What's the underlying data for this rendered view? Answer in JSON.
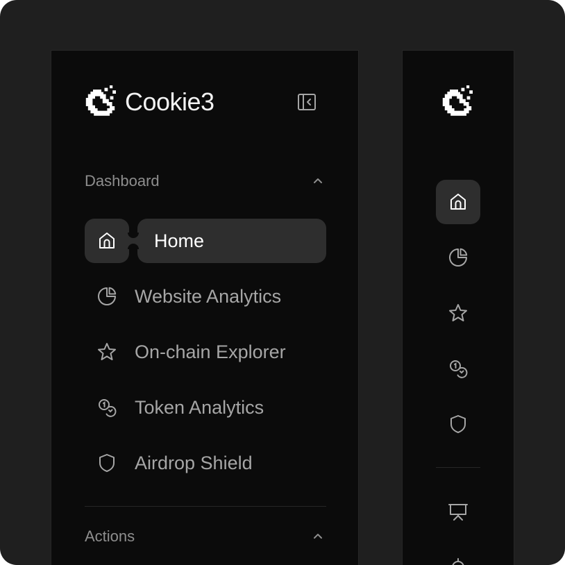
{
  "brand": {
    "name": "Cookie3",
    "logo_icon": "cookie3-logo-icon"
  },
  "sidebar": {
    "collapse_icon": "sidebar-collapse-icon",
    "sections": [
      {
        "label": "Dashboard",
        "chevron_icon": "chevron-up-icon",
        "items": [
          {
            "label": "Home",
            "icon": "home-icon",
            "active": true
          },
          {
            "label": "Website Analytics",
            "icon": "pie-chart-icon",
            "active": false
          },
          {
            "label": "On-chain Explorer",
            "icon": "star-icon",
            "active": false
          },
          {
            "label": "Token Analytics",
            "icon": "coins-icon",
            "active": false
          },
          {
            "label": "Airdrop Shield",
            "icon": "shield-icon",
            "active": false
          }
        ]
      },
      {
        "label": "Actions",
        "chevron_icon": "chevron-up-icon",
        "items": []
      }
    ]
  },
  "collapsed_sidebar": {
    "items": [
      "home-icon",
      "pie-chart-icon",
      "star-icon",
      "coins-icon",
      "shield-icon",
      "presentation-icon",
      "target-icon"
    ]
  },
  "colors": {
    "background": "#1f1f1f",
    "panel": "#0b0b0b",
    "active_bg": "#2e2e2e",
    "text_active": "#ffffff",
    "text_inactive": "#a6a6a6",
    "section_label": "#8e8e8e"
  }
}
